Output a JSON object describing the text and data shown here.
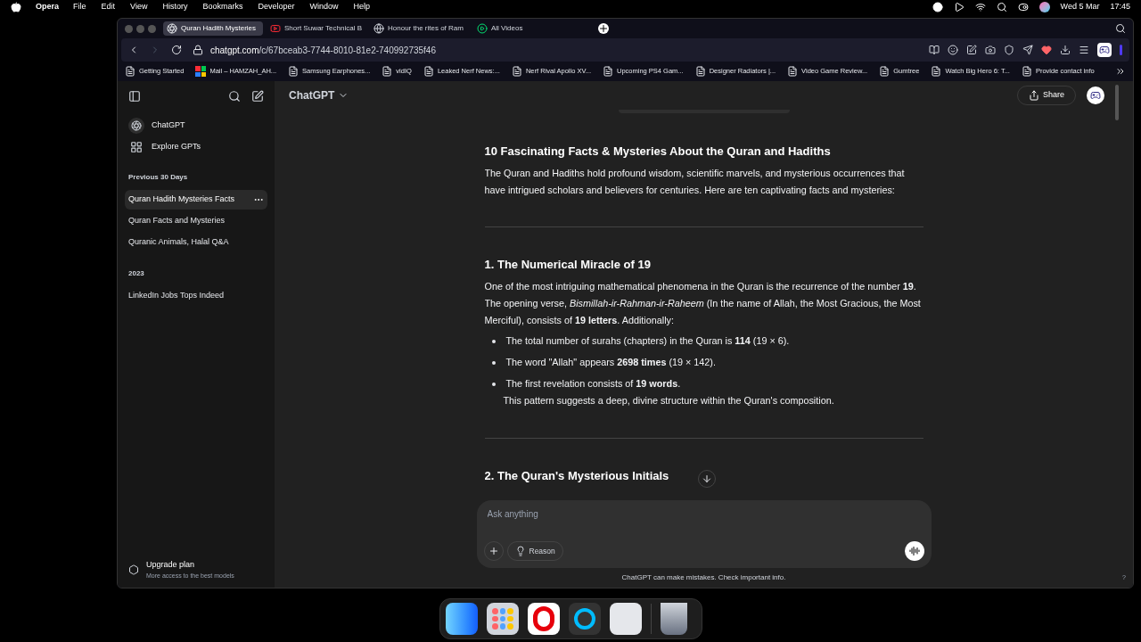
{
  "menubar": {
    "app": "Opera",
    "menus": [
      "File",
      "Edit",
      "View",
      "History",
      "Bookmarks",
      "Developer",
      "Window",
      "Help"
    ],
    "date": "Wed 5 Mar",
    "time": "17:45"
  },
  "tabs": [
    {
      "title": "Quran Hadith Mysteries",
      "kind": "chat",
      "selected": true
    },
    {
      "title": "Short Suwar Technical B",
      "kind": "video",
      "selected": false
    },
    {
      "title": "Honour the rites of Ram",
      "kind": "globe",
      "selected": false
    },
    {
      "title": "All Videos",
      "kind": "play",
      "selected": false
    }
  ],
  "address": {
    "host": "chatgpt.com",
    "path": "/c/67bceab3-7744-8010-81e2-740992735f46"
  },
  "bookmarks": [
    {
      "label": "Getting Started",
      "kind": "page"
    },
    {
      "label": "Mail – HAMZAH_AH...",
      "kind": "mail"
    },
    {
      "label": "Samsung Earphones...",
      "kind": "page"
    },
    {
      "label": "vidIQ",
      "kind": "page"
    },
    {
      "label": "Leaked Nerf News:...",
      "kind": "page"
    },
    {
      "label": "Nerf Rival Apollo XV...",
      "kind": "page"
    },
    {
      "label": "Upcoming PS4 Gam...",
      "kind": "page"
    },
    {
      "label": "Designer Radiators |...",
      "kind": "page"
    },
    {
      "label": "Video Game Review...",
      "kind": "page"
    },
    {
      "label": "Gumtree",
      "kind": "page"
    },
    {
      "label": "Watch Big Hero 6: T...",
      "kind": "page"
    },
    {
      "label": "Provide contact info",
      "kind": "page"
    }
  ],
  "sidebar": {
    "nav": [
      {
        "label": "ChatGPT",
        "kind": "logo"
      },
      {
        "label": "Explore GPTs",
        "kind": "grid"
      }
    ],
    "sections": [
      {
        "heading": "Previous 30 Days",
        "chats": [
          {
            "title": "Quran Hadith Mysteries Facts",
            "selected": true
          },
          {
            "title": "Quran Facts and Mysteries",
            "selected": false
          },
          {
            "title": "Quranic Animals, Halal Q&A",
            "selected": false
          }
        ]
      },
      {
        "heading": "2023",
        "chats": [
          {
            "title": "LinkedIn Jobs Tops Indeed",
            "selected": false
          }
        ]
      }
    ],
    "upgrade": {
      "title": "Upgrade plan",
      "subtitle": "More access to the best models"
    }
  },
  "header": {
    "model": "ChatGPT",
    "share": "Share"
  },
  "article": {
    "title": "10 Fascinating Facts & Mysteries About the Quran and Hadiths",
    "intro": "The Quran and Hadiths hold profound wisdom, scientific marvels, and mysterious occurrences that have intrigued scholars and believers for centuries. Here are ten captivating facts and mysteries:",
    "sections": [
      {
        "heading": "1. The Numerical Miracle of 19",
        "paragraph": "One of the most intriguing mathematical phenomena in the Quran is the recurrence of the number **19**. The opening verse, *Bismillah-ir-Rahman-ir-Raheem* (In the name of Allah, the Most Gracious, the Most Merciful), consists of **19 letters**. Additionally:",
        "bullets": [
          "The total number of surahs (chapters) in the Quran is **114** (19 × 6).",
          "The word \"Allah\" appears **2698 times** (19 × 142).",
          "The first revelation consists of **19 words**."
        ],
        "note": "This pattern suggests a deep, divine structure within the Quran's composition."
      }
    ],
    "next_heading": "2. The Quran's Mysterious Initials"
  },
  "composer": {
    "placeholder": "Ask anything",
    "reason": "Reason",
    "disclaimer": "ChatGPT can make mistakes. Check important info.",
    "help": "?"
  }
}
